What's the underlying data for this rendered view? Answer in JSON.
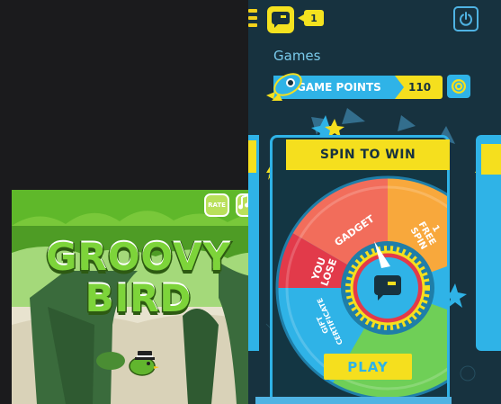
{
  "game_card": {
    "title_line1": "GROOVY",
    "title_line2": "BIRD",
    "rate_label": "RATE",
    "sound_icon": "music-note-icon",
    "colors": {
      "grass": "#6fc62e",
      "trunk": "#3a6b3c",
      "text": "#7dd43a"
    }
  },
  "header": {
    "menu_icon": "hamburger-icon",
    "logo_icon": "chat-logo-icon",
    "notification_count": "1",
    "power_icon": "power-icon"
  },
  "section": {
    "title": "Games"
  },
  "points": {
    "label": "GAME POINTS",
    "value": "110",
    "rocket_icon": "rocket-icon",
    "coin_icon": "coin-icon"
  },
  "wheel": {
    "banner": "SPIN TO WIN",
    "segments": [
      {
        "label": "GADGET",
        "color": "#f26d5b"
      },
      {
        "label": "1 FREE SPIN",
        "color": "#f8a83c"
      },
      {
        "label": "YOU LOSE",
        "color": "#e23a4a"
      },
      {
        "label": "GIFT CERTIFICATE",
        "color": "#2fb3e7"
      },
      {
        "label": "",
        "color": "#6fcf57"
      }
    ],
    "center_icon": "chat-logo-icon",
    "play_label": "PLAY"
  },
  "colors": {
    "app_bg": "#17323f",
    "accent_yellow": "#f5df1e",
    "accent_blue": "#2fb3e7"
  }
}
